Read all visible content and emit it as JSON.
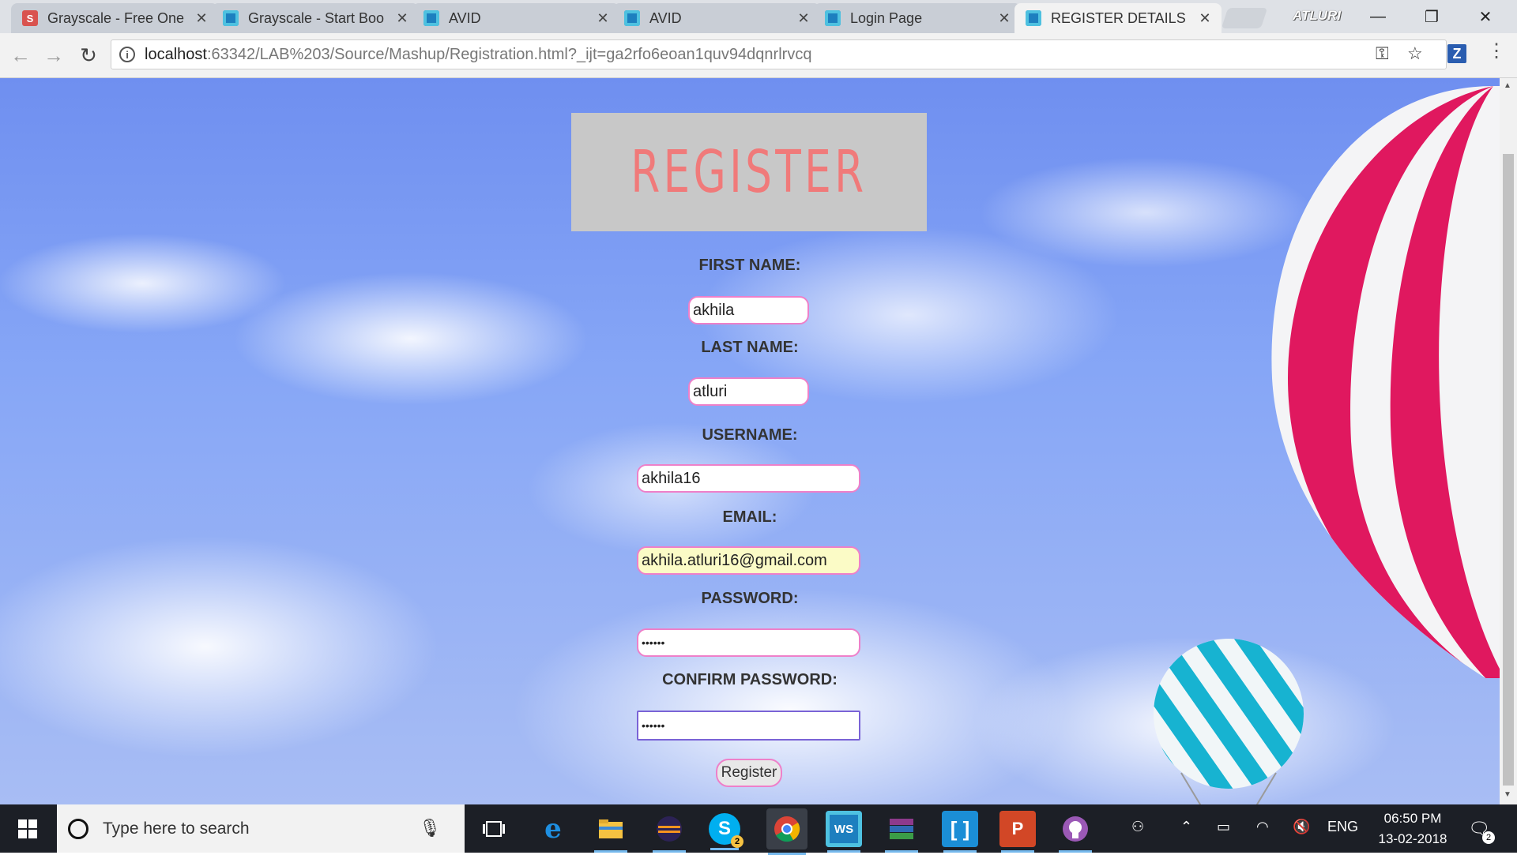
{
  "browser": {
    "tabs": [
      {
        "title": "Grayscale - Free One",
        "icon": "s-favicon",
        "active": false
      },
      {
        "title": "Grayscale - Start Boo",
        "icon": "webstorm-favicon",
        "active": false
      },
      {
        "title": "AVID",
        "icon": "webstorm-favicon",
        "active": false
      },
      {
        "title": "AVID",
        "icon": "webstorm-favicon",
        "active": false
      },
      {
        "title": "Login Page",
        "icon": "webstorm-favicon",
        "active": false
      },
      {
        "title": "REGISTER DETAILS",
        "icon": "webstorm-favicon",
        "active": true
      }
    ],
    "profile_name": "ATLURI",
    "url_host": "localhost",
    "url_rest": ":63342/LAB%203/Source/Mashup/Registration.html?_ijt=ga2rfo6eoan1quv94dqnrlrvcq",
    "extension_label": "Z"
  },
  "page": {
    "banner_title": "REGISTER",
    "fields": {
      "first_name": {
        "label": "FIRST NAME:",
        "value": "akhila"
      },
      "last_name": {
        "label": "LAST NAME:",
        "value": "atluri"
      },
      "username": {
        "label": "USERNAME:",
        "value": "akhila16"
      },
      "email": {
        "label": "EMAIL:",
        "value": "akhila.atluri16@gmail.com"
      },
      "password": {
        "label": "PASSWORD:",
        "value": "••••••"
      },
      "confirm_password": {
        "label": "CONFIRM PASSWORD:",
        "value": "••••••"
      }
    },
    "submit_label": "Register"
  },
  "taskbar": {
    "search_placeholder": "Type here to search",
    "apps": [
      "task-view",
      "edge",
      "file-explorer",
      "eclipse",
      "skype",
      "chrome",
      "webstorm",
      "winrar",
      "brackets",
      "powerpoint",
      "github"
    ],
    "skype_badge": "2",
    "language": "ENG",
    "time": "06:50 PM",
    "date": "13-02-2018",
    "notification_count": "2"
  },
  "colors": {
    "title_pink": "#f07a7a",
    "input_border_pink": "#ee80c9",
    "autofill_yellow": "#fbfbc6",
    "banner_gray": "#c8c8c8"
  }
}
